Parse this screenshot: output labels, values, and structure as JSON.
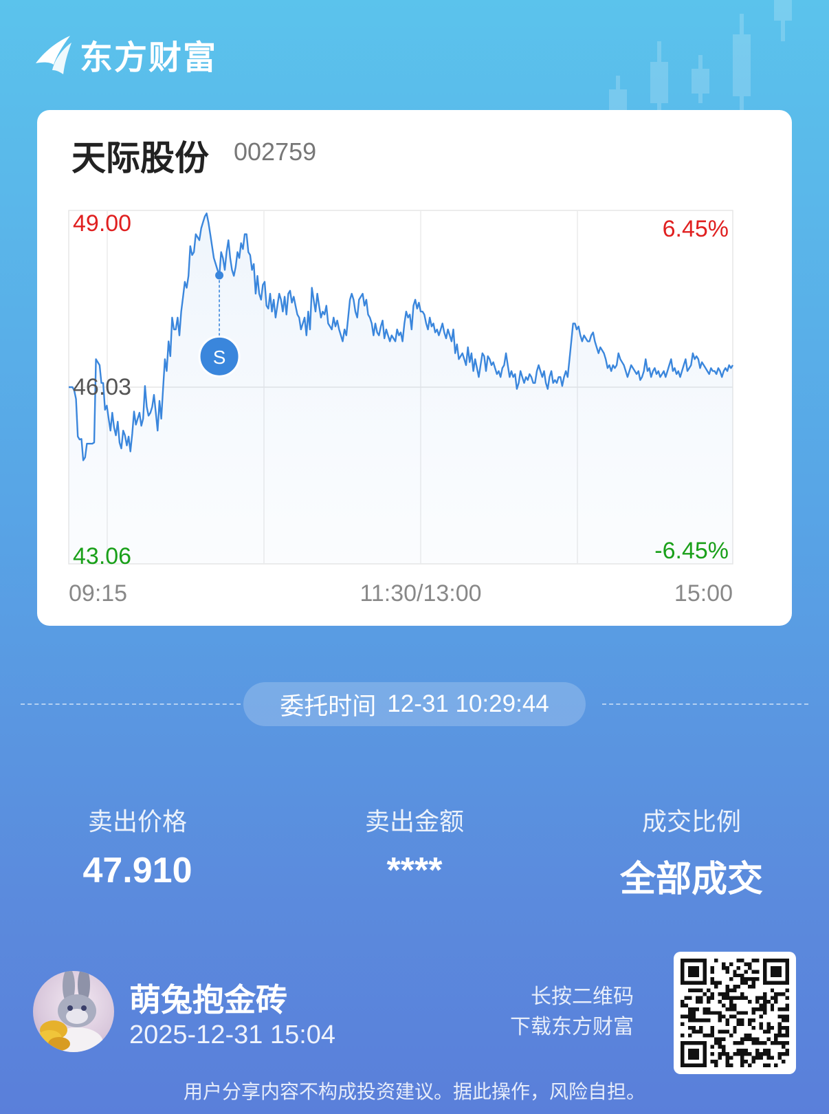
{
  "brand": {
    "name": "东方财富"
  },
  "stock": {
    "name": "天际股份",
    "code": "002759"
  },
  "chart_data": {
    "type": "line",
    "y_max_label": "49.00",
    "y_mid_label": "46.03",
    "y_min_label": "43.06",
    "pct_max_label": "6.45%",
    "pct_min_label": "-6.45%",
    "x_labels": [
      "09:15",
      "11:30/13:00",
      "15:00"
    ],
    "ylim": [
      43.06,
      49.0
    ],
    "prev_close": 46.03,
    "sell_marker": {
      "label": "S",
      "index": 83,
      "price": 47.91
    },
    "colors": {
      "line": "#3a86dc",
      "up": "#e02020",
      "down": "#1aa01a",
      "grid": "#e6e6e6"
    },
    "prices": [
      46.03,
      46.03,
      46.03,
      45.98,
      45.83,
      45.2,
      45.15,
      45.16,
      44.8,
      44.85,
      45.08,
      45.08,
      45.08,
      45.08,
      45.1,
      46.5,
      46.45,
      46.4,
      46.1,
      46.1,
      45.65,
      45.72,
      45.5,
      45.3,
      45.6,
      45.35,
      45.22,
      45.45,
      45.1,
      45.0,
      45.3,
      45.22,
      45.05,
      45.2,
      44.95,
      45.25,
      45.62,
      45.4,
      45.5,
      45.6,
      45.38,
      45.5,
      46.05,
      45.7,
      45.55,
      45.6,
      45.7,
      45.9,
      45.6,
      45.3,
      45.8,
      45.5,
      46.0,
      46.5,
      46.3,
      46.8,
      46.55,
      47.2,
      47.0,
      47.0,
      47.2,
      46.9,
      47.3,
      47.55,
      47.8,
      47.7,
      47.9,
      48.4,
      48.25,
      48.3,
      48.6,
      48.55,
      48.5,
      48.7,
      48.8,
      48.9,
      48.95,
      48.8,
      48.6,
      48.4,
      48.2,
      48.1,
      48.0,
      47.91,
      48.3,
      48.2,
      48.0,
      48.3,
      48.5,
      48.2,
      48.0,
      47.9,
      48.05,
      48.3,
      48.2,
      48.45,
      48.35,
      48.6,
      48.6,
      48.3,
      48.25,
      48.0,
      48.1,
      47.6,
      47.9,
      47.6,
      47.5,
      47.75,
      47.8,
      47.4,
      47.35,
      47.6,
      47.3,
      47.5,
      47.2,
      47.4,
      47.6,
      47.5,
      47.3,
      47.55,
      47.25,
      47.6,
      47.65,
      47.45,
      47.55,
      47.4,
      47.25,
      47.2,
      47.0,
      47.1,
      47.2,
      46.9,
      47.3,
      47.0,
      47.7,
      47.5,
      47.3,
      47.6,
      47.4,
      47.2,
      47.3,
      47.25,
      47.4,
      47.1,
      47.05,
      47.0,
      47.2,
      47.05,
      47.15,
      47.0,
      46.9,
      46.8,
      47.0,
      46.9,
      47.2,
      47.5,
      47.6,
      47.5,
      47.3,
      47.2,
      47.5,
      47.55,
      47.6,
      47.4,
      47.5,
      47.25,
      47.2,
      47.1,
      46.9,
      47.1,
      46.95,
      46.9,
      47.05,
      47.15,
      46.85,
      47.0,
      46.9,
      46.8,
      46.9,
      46.85,
      46.8,
      47.0,
      46.9,
      46.95,
      46.8,
      47.1,
      47.3,
      47.2,
      47.25,
      47.0,
      47.4,
      47.5,
      47.35,
      47.45,
      47.3,
      47.3,
      47.25,
      47.1,
      47.0,
      47.2,
      47.05,
      47.1,
      46.95,
      47.0,
      46.9,
      47.0,
      47.1,
      46.95,
      46.85,
      47.0,
      46.9,
      46.8,
      47.0,
      46.6,
      46.75,
      46.5,
      46.55,
      46.6,
      46.5,
      46.4,
      46.7,
      46.45,
      46.6,
      46.3,
      46.5,
      46.35,
      46.2,
      46.4,
      46.6,
      46.55,
      46.3,
      46.55,
      46.5,
      46.4,
      46.45,
      46.35,
      46.25,
      46.3,
      46.2,
      46.35,
      46.4,
      46.6,
      46.4,
      46.2,
      46.3,
      46.2,
      46.25,
      46.0,
      46.1,
      46.3,
      46.2,
      46.1,
      46.2,
      46.15,
      46.25,
      46.2,
      46.1,
      46.1,
      46.3,
      46.4,
      46.3,
      46.2,
      46.3,
      46.1,
      46.0,
      46.2,
      46.3,
      46.1,
      46.15,
      46.1,
      46.2,
      46.2,
      46.05,
      46.2,
      46.3,
      46.2,
      46.5,
      46.8,
      47.1,
      47.1,
      47.0,
      47.05,
      46.9,
      46.8,
      46.9,
      46.85,
      46.8,
      46.8,
      46.9,
      46.95,
      46.8,
      46.7,
      46.6,
      46.7,
      46.65,
      46.6,
      46.5,
      46.35,
      46.4,
      46.3,
      46.4,
      46.35,
      46.4,
      46.6,
      46.5,
      46.45,
      46.4,
      46.3,
      46.2,
      46.3,
      46.4,
      46.35,
      46.3,
      46.25,
      46.3,
      46.15,
      46.2,
      46.3,
      46.5,
      46.3,
      46.35,
      46.2,
      46.3,
      46.35,
      46.25,
      46.3,
      46.2,
      46.25,
      46.3,
      46.2,
      46.3,
      46.4,
      46.5,
      46.3,
      46.35,
      46.25,
      46.3,
      46.2,
      46.3,
      46.4,
      46.5,
      46.3,
      46.35,
      46.4,
      46.6,
      46.5,
      46.55,
      46.5,
      46.35,
      46.45,
      46.4,
      46.35,
      46.3,
      46.25,
      46.35,
      46.3,
      46.3,
      46.25,
      46.35,
      46.3,
      46.2,
      46.3,
      46.35,
      46.3,
      46.4,
      46.35,
      46.4
    ]
  },
  "order": {
    "label": "委托时间",
    "time": "12-31 10:29:44"
  },
  "stats": [
    {
      "label": "卖出价格",
      "value": "47.910"
    },
    {
      "label": "卖出金额",
      "value": "****"
    },
    {
      "label": "成交比例",
      "value": "全部成交"
    }
  ],
  "user": {
    "name": "萌兔抱金砖",
    "time": "2025-12-31 15:04"
  },
  "qr": {
    "hint_line1": "长按二维码",
    "hint_line2": "下载东方财富"
  },
  "disclaimer": "用户分享内容不构成投资建议。据此操作，风险自担。"
}
